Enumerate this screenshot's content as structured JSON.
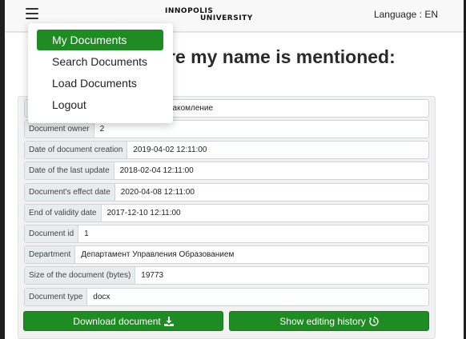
{
  "header": {
    "logo_line1": "INNOPOLIS",
    "logo_line2": "UNIVERSITY",
    "language_label": "Language : EN"
  },
  "menu": {
    "items": [
      {
        "label": "My Documents",
        "active": true
      },
      {
        "label": "Search Documents",
        "active": false
      },
      {
        "label": "Load Documents",
        "active": false
      },
      {
        "label": "Logout",
        "active": false
      }
    ]
  },
  "page": {
    "title_visible": "re my name is mentioned:"
  },
  "document": {
    "rows": [
      {
        "key": "",
        "value": "накомление"
      },
      {
        "key": "Document owner",
        "value": "2"
      },
      {
        "key": "Date of document creation",
        "value": "2019-04-02 12:11:00"
      },
      {
        "key": "Date of the last update",
        "value": "2018-02-04 12:11:00"
      },
      {
        "key": "Document's effect date",
        "value": "2020-04-08 12:11:00"
      },
      {
        "key": "End of validity date",
        "value": "2017-12-10 12:11:00"
      },
      {
        "key": "Document id",
        "value": "1"
      },
      {
        "key": "Department",
        "value": "Департамент Управления Образованием"
      },
      {
        "key": "Size of the document (bytes)",
        "value": "19773"
      },
      {
        "key": "Document type",
        "value": "docx"
      }
    ],
    "download_label": "Download document",
    "history_label": "Show editing history"
  },
  "icons": {
    "download": "download-icon",
    "history": "history-icon",
    "menu": "hamburger-icon"
  },
  "colors": {
    "accent": "#1e8c22"
  }
}
